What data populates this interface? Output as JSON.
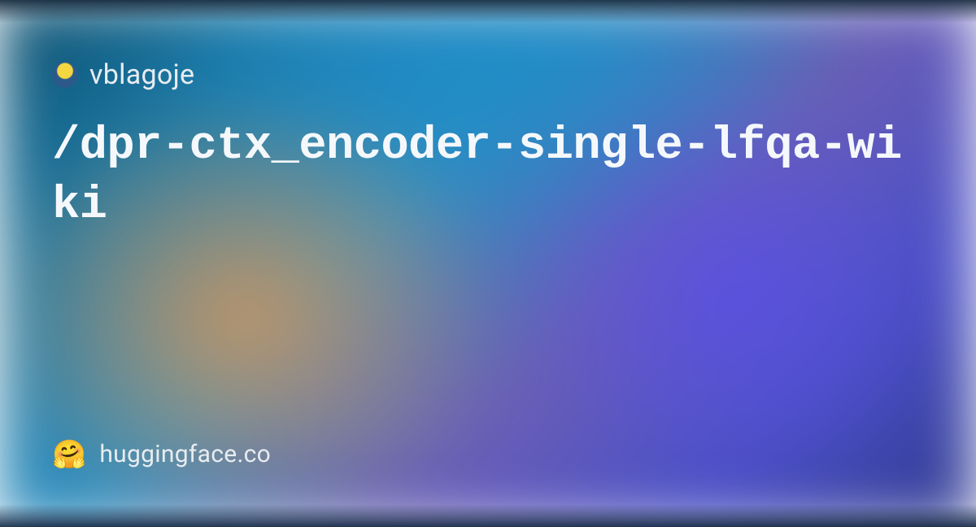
{
  "author": {
    "name": "vblagoje"
  },
  "title": "/dpr-ctx_encoder-single-lfqa-wiki",
  "footer": {
    "site": "huggingface.co",
    "logo_emoji": "🤗"
  }
}
